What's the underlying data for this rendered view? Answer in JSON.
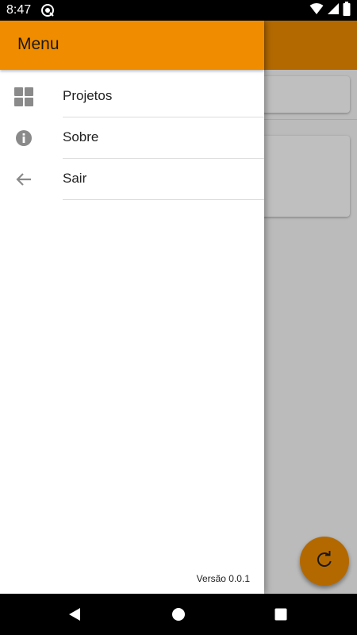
{
  "status_bar": {
    "time": "8:47"
  },
  "drawer": {
    "title": "Menu",
    "items": [
      {
        "label": "Projetos",
        "icon": "dashboard-icon"
      },
      {
        "label": "Sobre",
        "icon": "info-icon"
      },
      {
        "label": "Sair",
        "icon": "arrow-back-icon"
      }
    ],
    "version": "Versão 0.0.1"
  },
  "colors": {
    "accent": "#f08c00",
    "icon_gray": "#8a8a8a"
  }
}
